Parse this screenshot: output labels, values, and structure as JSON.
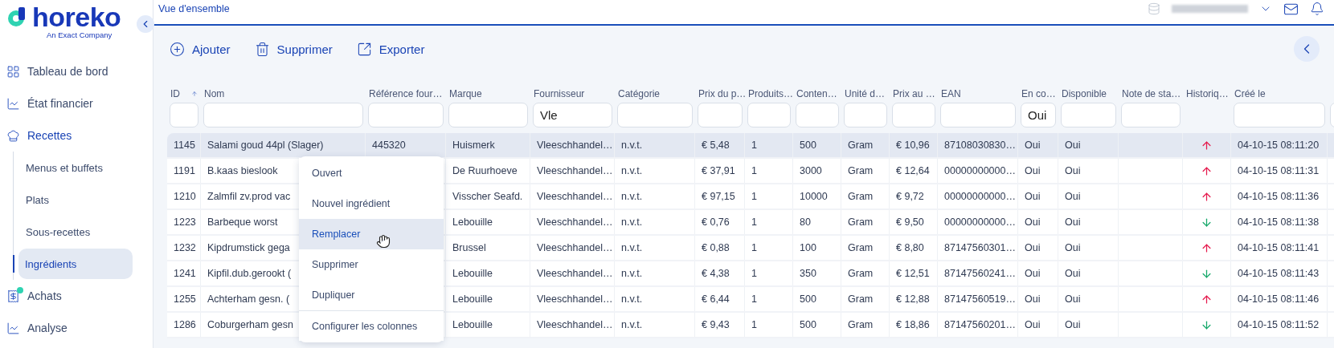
{
  "sidebar": {
    "logo": "horeko",
    "tagline": "An Exact Company",
    "items": [
      {
        "label": "Tableau de bord",
        "selected": false,
        "badge": false
      },
      {
        "label": "État financier",
        "selected": false,
        "badge": false
      },
      {
        "label": "Recettes",
        "selected": true,
        "badge": false,
        "expanded": true,
        "children": [
          {
            "label": "Menus et buffets",
            "selected": false
          },
          {
            "label": "Plats",
            "selected": false
          },
          {
            "label": "Sous-recettes",
            "selected": false
          },
          {
            "label": "Ingrédients",
            "selected": true
          }
        ]
      },
      {
        "label": "Achats",
        "selected": false,
        "badge": true
      },
      {
        "label": "Analyse",
        "selected": false,
        "badge": false
      }
    ]
  },
  "header": {
    "breadcrumb": "Vue d'ensemble"
  },
  "toolbar": {
    "actions": [
      "Ajouter",
      "Supprimer",
      "Exporter"
    ]
  },
  "table": {
    "columns": [
      {
        "label": "ID",
        "sorted": true,
        "filterable": true
      },
      {
        "label": "Nom",
        "sorted": false,
        "filterable": true
      },
      {
        "label": "Référence four…",
        "sorted": false,
        "filterable": true
      },
      {
        "label": "Marque",
        "sorted": false,
        "filterable": true
      },
      {
        "label": "Fournisseur",
        "sorted": false,
        "filterable": true,
        "filter": "Vle"
      },
      {
        "label": "Catégorie",
        "sorted": false,
        "filterable": true
      },
      {
        "label": "Prix du p…",
        "sorted": false,
        "filterable": true
      },
      {
        "label": "Produits…",
        "sorted": false,
        "filterable": true
      },
      {
        "label": "Conten…",
        "sorted": false,
        "filterable": true
      },
      {
        "label": "Unité d…",
        "sorted": false,
        "filterable": true
      },
      {
        "label": "Prix au …",
        "sorted": false,
        "filterable": true
      },
      {
        "label": "EAN",
        "sorted": false,
        "filterable": true
      },
      {
        "label": "En co…",
        "sorted": false,
        "filterable": true,
        "filter": "Oui"
      },
      {
        "label": "Disponible",
        "sorted": false,
        "filterable": true
      },
      {
        "label": "Note de sta…",
        "sorted": false,
        "filterable": true
      },
      {
        "label": "Historiq…",
        "sorted": false,
        "filterable": false
      },
      {
        "label": "Créé le",
        "sorted": false,
        "filterable": true
      },
      {
        "sorted": false,
        "filterable": true
      }
    ],
    "rows": [
      {
        "selected": true,
        "id": "1145",
        "name": "Salami goud 44pl (Slager)",
        "reference": "445320",
        "brand": "Huismerk",
        "supplier": "Vleeschhandel…",
        "category": "n.v.t.",
        "price": "€ 5,48",
        "products": "1",
        "content": "500",
        "unit": "Gram",
        "unit_price": "€ 10,96",
        "ean": "87108030830…",
        "in_stock": "Oui",
        "available": "Oui",
        "rising": true,
        "created": "04-10-15 08:11:20"
      },
      {
        "selected": false,
        "id": "1191",
        "name": "B.kaas bieslook",
        "brand": "De Ruurhoeve",
        "supplier": "Vleeschhandel…",
        "category": "n.v.t.",
        "price": "€ 37,91",
        "products": "1",
        "content": "3000",
        "unit": "Gram",
        "unit_price": "€ 12,64",
        "ean": "00000000000…",
        "in_stock": "Oui",
        "available": "Oui",
        "rising": true,
        "created": "04-10-15 08:11:31"
      },
      {
        "selected": false,
        "id": "1210",
        "name": "Zalmfil zv.prod vac",
        "brand": "Visscher Seafd.",
        "supplier": "Vleeschhandel…",
        "category": "n.v.t.",
        "price": "€ 97,15",
        "products": "1",
        "content": "10000",
        "unit": "Gram",
        "unit_price": "€ 9,72",
        "ean": "00000000000…",
        "in_stock": "Oui",
        "available": "Oui",
        "rising": true,
        "created": "04-10-15 08:11:36"
      },
      {
        "selected": false,
        "id": "1223",
        "name": "Barbeque worst",
        "brand": "Lebouille",
        "supplier": "Vleeschhandel…",
        "category": "n.v.t.",
        "price": "€ 0,76",
        "products": "1",
        "content": "80",
        "unit": "Gram",
        "unit_price": "€ 9,50",
        "ean": "00000000000…",
        "in_stock": "Oui",
        "available": "Oui",
        "rising": false,
        "created": "04-10-15 08:11:38"
      },
      {
        "selected": false,
        "id": "1232",
        "name": "Kipdrumstick gega",
        "brand": "Brussel",
        "supplier": "Vleeschhandel…",
        "category": "n.v.t.",
        "price": "€ 0,88",
        "products": "1",
        "content": "100",
        "unit": "Gram",
        "unit_price": "€ 8,80",
        "ean": "87147560301…",
        "in_stock": "Oui",
        "available": "Oui",
        "rising": true,
        "created": "04-10-15 08:11:41"
      },
      {
        "selected": false,
        "id": "1241",
        "name": "Kipfil.dub.gerookt (",
        "brand": "Lebouille",
        "supplier": "Vleeschhandel…",
        "category": "n.v.t.",
        "price": "€ 4,38",
        "products": "1",
        "content": "350",
        "unit": "Gram",
        "unit_price": "€ 12,51",
        "ean": "87147560241…",
        "in_stock": "Oui",
        "available": "Oui",
        "rising": false,
        "created": "04-10-15 08:11:43"
      },
      {
        "selected": false,
        "id": "1255",
        "name": "Achterham gesn. (",
        "brand": "Lebouille",
        "supplier": "Vleeschhandel…",
        "category": "n.v.t.",
        "price": "€ 6,44",
        "products": "1",
        "content": "500",
        "unit": "Gram",
        "unit_price": "€ 12,88",
        "ean": "87147560519…",
        "in_stock": "Oui",
        "available": "Oui",
        "rising": true,
        "created": "04-10-15 08:11:46"
      },
      {
        "selected": false,
        "id": "1286",
        "name": "Coburgerham gesn",
        "brand": "Lebouille",
        "supplier": "Vleeschhandel…",
        "category": "n.v.t.",
        "price": "€ 9,43",
        "products": "1",
        "content": "500",
        "unit": "Gram",
        "unit_price": "€ 18,86",
        "ean": "87147560201…",
        "in_stock": "Oui",
        "available": "Oui",
        "rising": false,
        "created": "04-10-15 08:11:52"
      }
    ]
  },
  "context_menu": {
    "items": [
      {
        "label": "Ouvert",
        "selected": false,
        "separated": false
      },
      {
        "label": "Nouvel ingrédient",
        "selected": false,
        "separated": false
      },
      {
        "label": "Remplacer",
        "selected": true,
        "separated": false
      },
      {
        "label": "Supprimer",
        "selected": false,
        "separated": false
      },
      {
        "label": "Dupliquer",
        "selected": false,
        "separated": false
      },
      {
        "label": "Configurer les colonnes",
        "selected": false,
        "separated": true
      }
    ]
  }
}
